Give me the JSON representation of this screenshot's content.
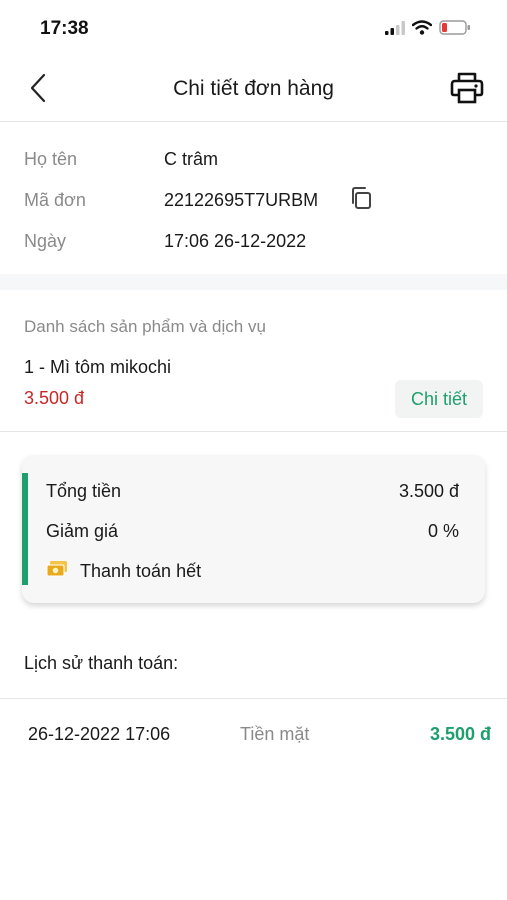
{
  "status_bar": {
    "time": "17:38"
  },
  "header": {
    "title": "Chi tiết đơn hàng",
    "back_icon": "chevron-left-icon",
    "print_icon": "printer-icon"
  },
  "order_info": {
    "name_label": "Họ tên",
    "name_value": "C trâm",
    "code_label": "Mã đơn",
    "code_value": "22122695T7URBM",
    "date_label": "Ngày",
    "date_value": "17:06 26-12-2022"
  },
  "products": {
    "heading": "Danh sách sản phẩm và dịch vụ",
    "items": [
      {
        "name": "1 - Mì tôm mikochi",
        "price": "3.500 đ",
        "detail_label": "Chi tiết"
      }
    ]
  },
  "summary": {
    "total_label": "Tổng tiền",
    "total_value": "3.500 đ",
    "discount_label": "Giảm giá",
    "discount_value": "0 %",
    "paid_label": "Thanh toán hết",
    "paid_icon": "money-icon"
  },
  "history": {
    "heading": "Lịch sử thanh toán:",
    "rows": [
      {
        "datetime": "26-12-2022 17:06",
        "method": "Tiền mặt",
        "amount": "3.500 đ"
      }
    ]
  },
  "colors": {
    "accent_green": "#1f9e6e",
    "price_red": "#c62828",
    "muted_gray": "#8a8a8a",
    "battery_red": "#e53935"
  }
}
